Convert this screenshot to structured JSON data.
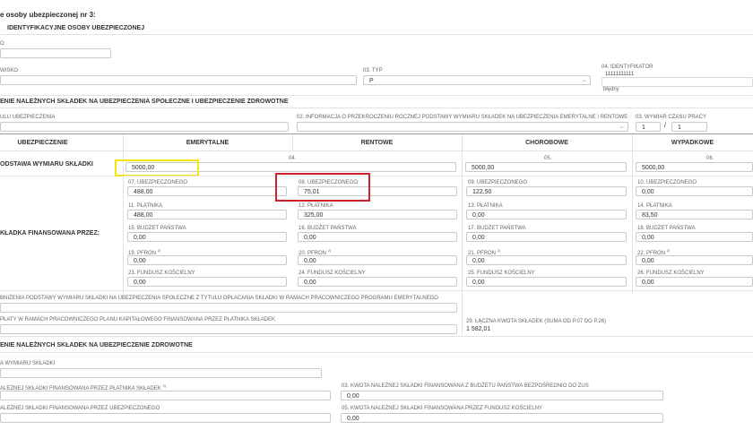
{
  "header": {
    "title": "e osoby ubezpieczonej nr 3:"
  },
  "identification": {
    "section_title": "IDENTYFIKACYJNE OSOBY UBEZPIECZONEJ",
    "label_o": "O",
    "label_nazwisko": "WISKO",
    "label_typ": "03. TYP",
    "typ_value": "P",
    "label_identyfikator": "04. IDENTYFIKATOR",
    "identyfikator_value": "11111111111",
    "identyfikator_status": "błędny"
  },
  "social": {
    "section_title": "ENIE NALEŻNYCH SKŁADEK NA UBEZPIECZENIA SPOŁECZNE I UBEZPIECZENIE ZDROWOTNE",
    "label_kod": "ULU UBEZPIECZENIA",
    "label_info": "02. INFORMACJA O PRZEKROCZENIU ROCZNEJ PODSTAWY WYMIARU SKŁADEK NA UBEZPIECZENIA EMERYTALNE I RENTOWE",
    "label_wymiar": "03. WYMIAR CZASU PRACY",
    "wymiar_num": "1",
    "wymiar_sep": "/",
    "wymiar_den": "1"
  },
  "columns": {
    "ubezpieczenie": "UBEZPIECZENIE",
    "emerytalne": "EMERYTALNE",
    "rentowe": "RENTOWE",
    "chorobowe": "CHOROBOWE",
    "wypadkowe": "WYPADKOWE"
  },
  "rows": {
    "podstawa": "ODSTAWA WYMIARU SKŁADKI",
    "finansowana": "KŁADKA FINANSOWANA PRZEZ:"
  },
  "podstawa": {
    "label_04": "04.",
    "value_emerytalne": "5000,00",
    "label_05": "05.",
    "value_chorobowe": "5000,00",
    "label_06": "06.",
    "value_wypadkowe": "5000,00"
  },
  "ubezpieczonego": {
    "l07": "07. UBEZPIECZONEGO",
    "v07": "488,00",
    "l08": "08. UBEZPIECZONEGO",
    "v08": "75,01",
    "l09": "09. UBEZPIECZONEGO",
    "v09": "122,50",
    "l10": "10. UBEZPIECZONEGO",
    "v10": "0,00"
  },
  "platnika": {
    "l11": "11. PŁATNIKA",
    "v11": "488,00",
    "l12": "12. PŁATNIKA",
    "v12": "325,00",
    "l13": "13. PŁATNIKA",
    "v13": "0,00",
    "l14": "14. PŁATNIKA",
    "v14": "83,50"
  },
  "budzet": {
    "l15": "15. BUDŻET PAŃSTWA",
    "v15": "0,00",
    "l16": "16. BUDŻET PAŃSTWA",
    "v16": "0,00",
    "l17": "17. BUDŻET PAŃSTWA",
    "v17": "0,00",
    "l18": "18. BUDŻET PAŃSTWA",
    "v18": "0,00"
  },
  "pfron": {
    "l19": "19. PFRON",
    "v19": "0,00",
    "l20": "20. PFRON",
    "v20": "0,00",
    "l21": "21. PFRON",
    "v21": "0,00",
    "l22": "22. PFRON",
    "v22": "0,00",
    "sup": "2)"
  },
  "fundusz": {
    "l23": "23. FUNDUSZ KOŚCIELNY",
    "v23": "0,00",
    "l24": "24. FUNDUSZ KOŚCIELNY",
    "v24": "0,00",
    "l25": "25. FUNDUSZ KOŚCIELNY",
    "v25": "0,00",
    "l26": "26. FUNDUSZ KOŚCIELNY",
    "v26": "0,00"
  },
  "bottom": {
    "obnizenie": "BNIŻENIA PODSTAWY WYMIARU SKŁADKI NA UBEZPIECZENIA SPOŁECZNE Z TYTUŁU OPŁACANIA SKŁADKI W RAMACH PRACOWNICZEGO PROGRAMU EMERYTALNEGO",
    "wplaty": "PŁATY W RAMACH PRACOWNICZEGO PLANU KAPITAŁOWEGO FINANSOWANA PRZEZ PŁATNIKA SKŁADEK",
    "laczna_label": "29. ŁĄCZNA KWOTA SKŁADEK (suma od P.07 DO P.26)",
    "laczna_value": "1 582,01"
  },
  "health": {
    "section_title": "ENIE NALEŻNYCH SKŁADEK NA UBEZPIECZENIE ZDROWOTNE",
    "label_podstawa": "A WYMIARU SKŁADKI",
    "label_platnik": "ALEŻNEJ SKŁADKI FINANSOWANA PRZEZ PŁATNIKA SKŁADEK",
    "platnik_sup": "3)",
    "label_03": "03. KWOTA NALEŻNEJ SKŁADKI FINANSOWANA Z BUDŻETU PAŃSTWA BEZPOŚREDNIO DO ZUS",
    "value_03": "0,00",
    "label_ubezp": "ALEŻNEJ SKŁADKI FINANSOWANA PRZEZ UBEZPIECZONEGO",
    "label_05": "05. KWOTA NALEŻNEJ SKŁADKI FINANSOWANA PRZEZ FUNDUSZ KOŚCIELNY",
    "value_05": "0,00"
  },
  "colors": {
    "highlight_yellow": "#f5e50a",
    "highlight_red": "#d0202a",
    "border": "#c9c9c9"
  }
}
